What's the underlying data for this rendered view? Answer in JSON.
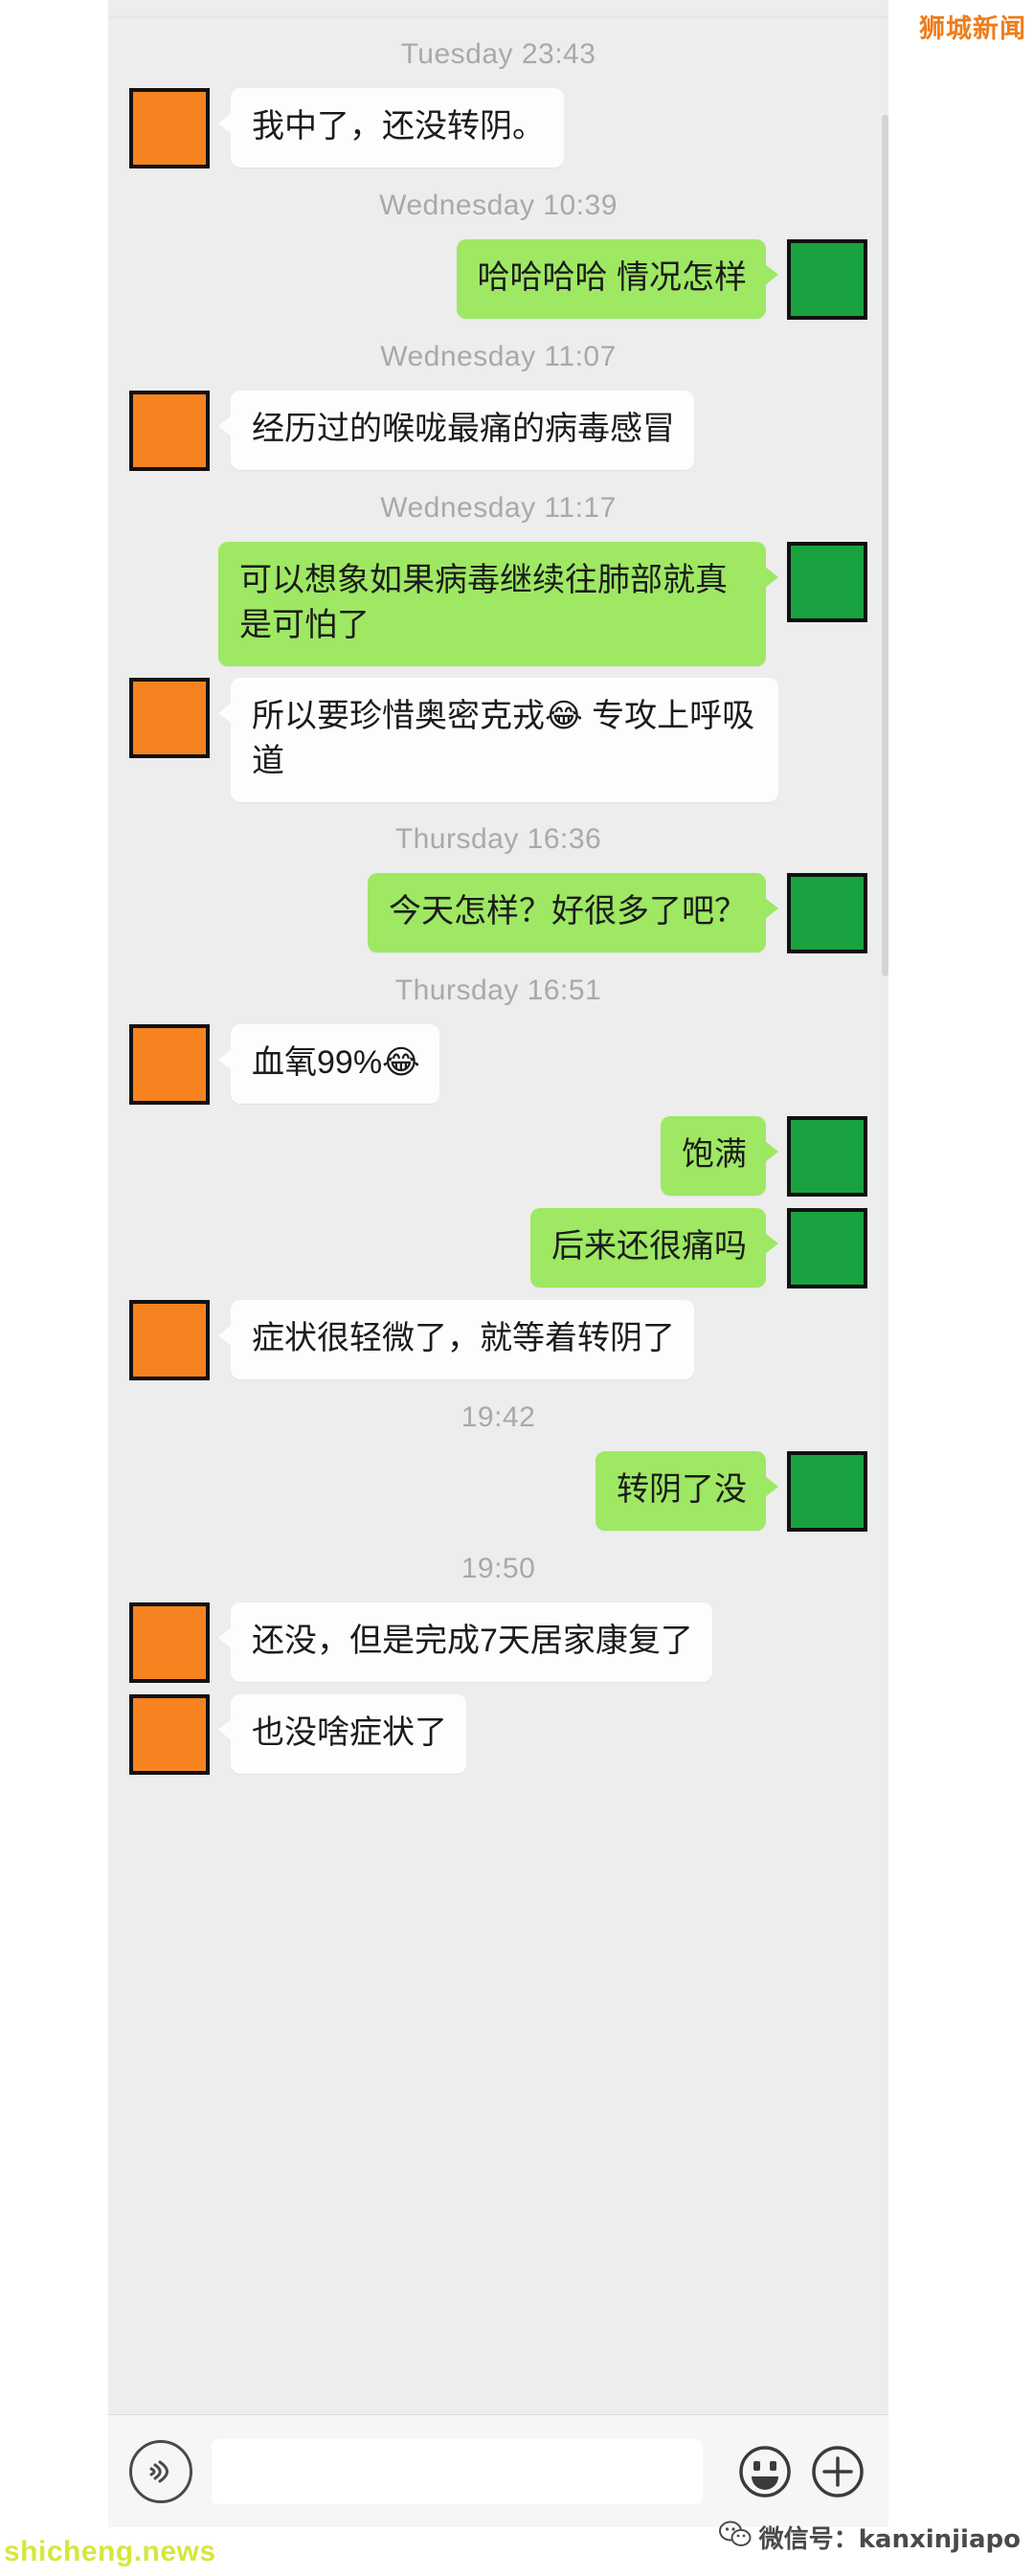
{
  "app": {
    "name": "WeChat",
    "bubble_colors": {
      "incoming": "#fdfdfd",
      "outgoing": "#9ee863",
      "background": "#ededed",
      "avatar_incoming": "#f6831f",
      "avatar_outgoing": "#1aa240"
    }
  },
  "messages": [
    {
      "type": "timestamp",
      "text": "Tuesday 23:43"
    },
    {
      "type": "message",
      "side": "in",
      "text": "我中了，还没转阴。"
    },
    {
      "type": "timestamp",
      "text": "Wednesday 10:39"
    },
    {
      "type": "message",
      "side": "out",
      "text": "哈哈哈哈 情况怎样"
    },
    {
      "type": "timestamp",
      "text": "Wednesday 11:07"
    },
    {
      "type": "message",
      "side": "in",
      "text": "经历过的喉咙最痛的病毒感冒"
    },
    {
      "type": "timestamp",
      "text": "Wednesday 11:17"
    },
    {
      "type": "message",
      "side": "out",
      "text": "可以想象如果病毒继续往肺部就真是可怕了"
    },
    {
      "type": "message",
      "side": "in",
      "text": "所以要珍惜奥密克戎😂 专攻上呼吸道"
    },
    {
      "type": "timestamp",
      "text": "Thursday 16:36"
    },
    {
      "type": "message",
      "side": "out",
      "text": "今天怎样？好很多了吧？"
    },
    {
      "type": "timestamp",
      "text": "Thursday 16:51"
    },
    {
      "type": "message",
      "side": "in",
      "text": "血氧99%😂"
    },
    {
      "type": "message",
      "side": "out",
      "text": "饱满"
    },
    {
      "type": "message",
      "side": "out",
      "text": "后来还很痛吗"
    },
    {
      "type": "message",
      "side": "in",
      "text": "症状很轻微了，就等着转阴了"
    },
    {
      "type": "timestamp",
      "text": "19:42"
    },
    {
      "type": "message",
      "side": "out",
      "text": "转阴了没"
    },
    {
      "type": "timestamp",
      "text": "19:50"
    },
    {
      "type": "message",
      "side": "in",
      "text": "还没，但是完成7天居家康复了"
    },
    {
      "type": "message",
      "side": "in",
      "text": "也没啥症状了"
    }
  ],
  "input_bar": {
    "voice_icon": "voice-wave-icon",
    "text_value": "",
    "text_placeholder": "",
    "emoji_icon": "smiley-face-icon",
    "more_icon": "plus-circle-icon"
  },
  "watermarks": {
    "top_right": "狮城新闻",
    "bottom_left": "shicheng.news",
    "bottom_right": "微信号：kanxinjiapo"
  }
}
